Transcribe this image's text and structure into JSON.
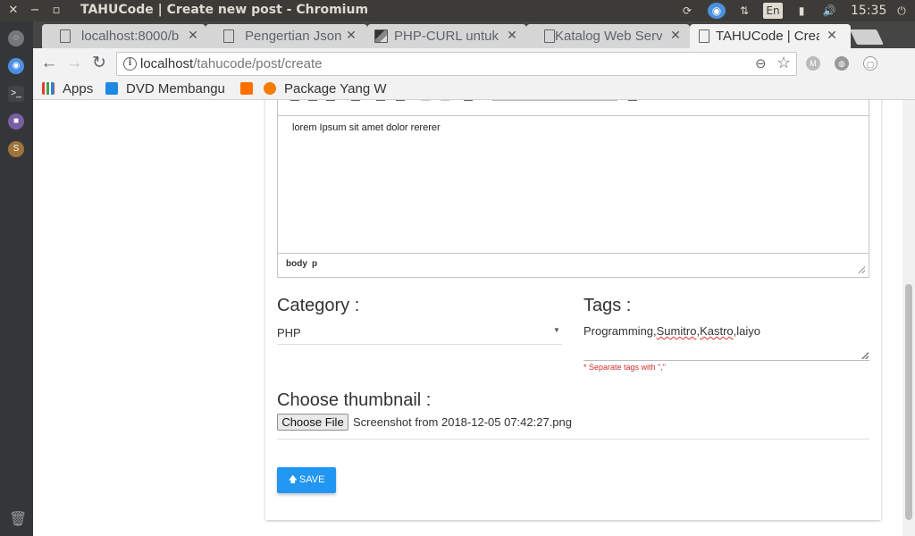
{
  "os": {
    "window_title": "TAHUCode | Create new post - Chromium",
    "close_glyph": "✕",
    "minimize_glyph": "−",
    "maximize_glyph": "▫",
    "keyboard_layout": "En",
    "time": "15:35"
  },
  "tabs": [
    {
      "title": "localhost:8000/b",
      "icon": "page-icon"
    },
    {
      "title": "Pengertian Json",
      "icon": "page-icon"
    },
    {
      "title": "PHP-CURL untuk",
      "icon": "image-favicon"
    },
    {
      "title": "Katalog Web Serv",
      "icon": "page-icon"
    },
    {
      "title": "TAHUCode | Crea",
      "icon": "page-icon",
      "active": true
    }
  ],
  "toolbar": {
    "url_host": "localhost",
    "url_path": "/tahucode/post/create"
  },
  "bookmarks": [
    {
      "label": "Apps",
      "color": "#4285f4"
    },
    {
      "label": "DVD Membangu",
      "color": "#1e88e5"
    },
    {
      "label": "",
      "color": "#ff6f00"
    },
    {
      "label": "Package Yang W",
      "color": "#f57c00"
    }
  ],
  "editor": {
    "content": "lorem Ipsum sit amet dolor rererer",
    "status_path": [
      "body",
      "p"
    ]
  },
  "form": {
    "category_label": "Category :",
    "category_value": "PHP",
    "tags_label": "Tags :",
    "tags_value": [
      "Programming,",
      "Sumitro",
      ",",
      "Kastro",
      ",laiyo"
    ],
    "tags_hint": "* Separate tags with \",\"",
    "thumbnail_label": "Choose thumbnail :",
    "file_button": "Choose File",
    "file_name": "Screenshot from 2018-12-05 07:42:27.png",
    "save_label": "SAVE"
  },
  "colors": {
    "accent": "#2196f3",
    "error": "#d32f2f"
  }
}
